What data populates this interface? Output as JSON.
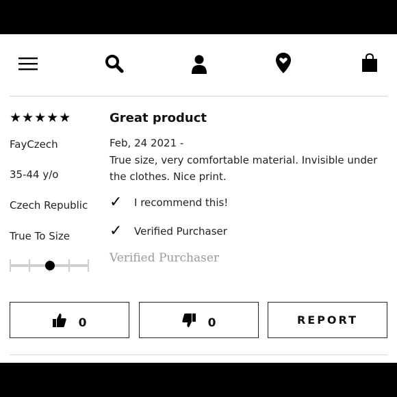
{
  "nav": {
    "icons": [
      "menu-icon",
      "search-icon",
      "account-icon",
      "location-icon",
      "bag-icon"
    ]
  },
  "review": {
    "stars_display": "★★★★★",
    "rating": 5,
    "author": "FayCzech",
    "age": "35-44 y/o",
    "country": "Czech Republic",
    "fit_label": "True To Size",
    "fit_value": 0.5,
    "title": "Great product",
    "date": "Feb, 24 2021 -",
    "text": "True size, very comfortable material. Invisible under the clothes. Nice print.",
    "recommend": "I recommend this!",
    "verified": "Verified Purchaser",
    "verified_badge": "Verified Purchaser"
  },
  "actions": {
    "helpful_count": "0",
    "unhelpful_count": "0",
    "report_label": "REPORT"
  }
}
